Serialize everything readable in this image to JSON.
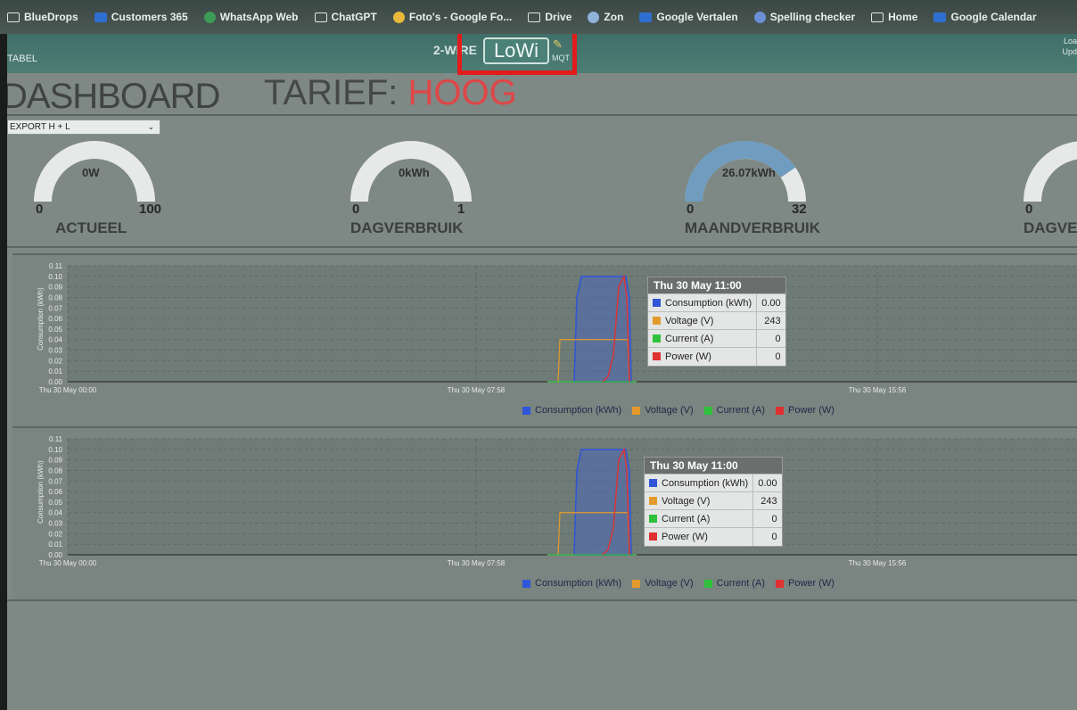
{
  "bookmarks": [
    {
      "label": "BlueDrops",
      "icon": "folder-icon"
    },
    {
      "label": "Customers 365",
      "icon": "dynamics-icon"
    },
    {
      "label": "WhatsApp Web",
      "icon": "whatsapp-icon"
    },
    {
      "label": "ChatGPT",
      "icon": "chatgpt-icon"
    },
    {
      "label": "Foto's - Google Fo...",
      "icon": "photos-icon"
    },
    {
      "label": "Drive",
      "icon": "folder-icon"
    },
    {
      "label": "Zon",
      "icon": "sun-icon"
    },
    {
      "label": "Google Vertalen",
      "icon": "translate-icon"
    },
    {
      "label": "Spelling checker",
      "icon": "spelling-icon"
    },
    {
      "label": "Home",
      "icon": "home-icon"
    },
    {
      "label": "Google Calendar",
      "icon": "calendar-icon"
    }
  ],
  "header": {
    "tabel": "TABEL",
    "mode": "2-WIRE",
    "logo": "LoWi",
    "mqtt": "MQT",
    "update": "Loa\nUpd"
  },
  "dashboard": {
    "title": "DASHBOARD",
    "tarief_label": "TARIEF:",
    "tarief_value": "HOOG",
    "select_value": "EXPORT H + L"
  },
  "gauges": [
    {
      "label": "ACTUEEL",
      "value_text": "0W",
      "min": "0",
      "max": "100",
      "level": 0
    },
    {
      "label": "DAGVERBRUIK",
      "value_text": "0kWh",
      "min": "0",
      "max": "1",
      "level": 0
    },
    {
      "label": "MAANDVERBRUIK",
      "value_text": "26.07kWh",
      "min": "0",
      "max": "32",
      "level": 0.81
    },
    {
      "label": "DAGVE",
      "value_text": "",
      "min": "0",
      "max": "",
      "level": 0
    }
  ],
  "chart_data": [
    {
      "type": "line",
      "ylabel": "Consumption (kWh)",
      "y_ticks": [
        "0.11",
        "0.10",
        "0.09",
        "0.08",
        "0.07",
        "0.06",
        "0.05",
        "0.04",
        "0.03",
        "0.02",
        "0.01",
        "0.00"
      ],
      "x_ticks": [
        "Thu 30 May 00:00",
        "Thu 30 May 07:58",
        "Thu 30 May 15:56"
      ],
      "legend": [
        "Consumption (kWh)",
        "Voltage (V)",
        "Current (A)",
        "Power (W)"
      ],
      "series_colors": [
        "#2f56d6",
        "#e39a2c",
        "#2fc13a",
        "#e03131"
      ],
      "tooltip": {
        "title": "Thu 30 May 11:00",
        "rows": [
          {
            "name": "Consumption (kWh)",
            "value": "0.00",
            "color": "#2f56d6"
          },
          {
            "name": "Voltage (V)",
            "value": "243",
            "color": "#e39a2c"
          },
          {
            "name": "Current (A)",
            "value": "0",
            "color": "#2fc13a"
          },
          {
            "name": "Power (W)",
            "value": "0",
            "color": "#e03131"
          }
        ]
      }
    },
    {
      "type": "line",
      "ylabel": "Consumption (kWh)",
      "y_ticks": [
        "0.11",
        "0.10",
        "0.09",
        "0.08",
        "0.07",
        "0.06",
        "0.05",
        "0.04",
        "0.03",
        "0.02",
        "0.01",
        "0.00"
      ],
      "x_ticks": [
        "Thu 30 May 00:00",
        "Thu 30 May 07:58",
        "Thu 30 May 15:56"
      ],
      "legend": [
        "Consumption (kWh)",
        "Voltage (V)",
        "Current (A)",
        "Power (W)"
      ],
      "series_colors": [
        "#2f56d6",
        "#e39a2c",
        "#2fc13a",
        "#e03131"
      ],
      "tooltip": {
        "title": "Thu 30 May 11:00",
        "rows": [
          {
            "name": "Consumption (kWh)",
            "value": "0.00",
            "color": "#2f56d6"
          },
          {
            "name": "Voltage (V)",
            "value": "243",
            "color": "#e39a2c"
          },
          {
            "name": "Current (A)",
            "value": "0",
            "color": "#2fc13a"
          },
          {
            "name": "Power (W)",
            "value": "0",
            "color": "#e03131"
          }
        ]
      }
    }
  ]
}
